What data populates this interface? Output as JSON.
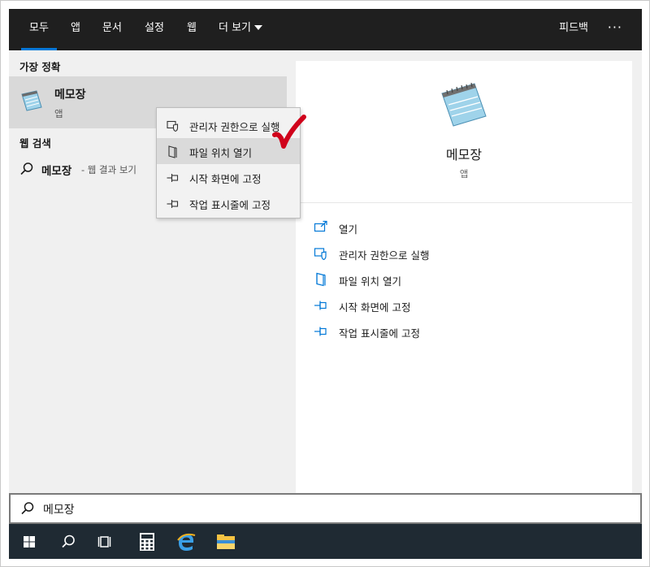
{
  "tabs": [
    {
      "label": "모두",
      "active": true
    },
    {
      "label": "앱"
    },
    {
      "label": "문서"
    },
    {
      "label": "설정"
    },
    {
      "label": "웹"
    },
    {
      "label": "더 보기"
    }
  ],
  "topbar": {
    "feedback": "피드백",
    "more": "···"
  },
  "left": {
    "best_match_title": "가장 정확",
    "best_match": {
      "name": "메모장",
      "kind": "앱",
      "icon": "notepad-icon"
    },
    "web_title": "웹 검색",
    "web_query": "메모장",
    "web_hint": "- 웹 결과 보기"
  },
  "context_menu": {
    "items": [
      {
        "label": "관리자 권한으로 실행",
        "icon": "shield-icon"
      },
      {
        "label": "파일 위치 열기",
        "icon": "folder-location-icon",
        "highlighted": true
      },
      {
        "label": "시작 화면에 고정",
        "icon": "pin-icon"
      },
      {
        "label": "작업 표시줄에 고정",
        "icon": "pin-icon"
      }
    ]
  },
  "right": {
    "title": "메모장",
    "subtitle": "앱",
    "actions": [
      {
        "label": "열기",
        "icon": "open-icon"
      },
      {
        "label": "관리자 권한으로 실행",
        "icon": "shield-icon"
      },
      {
        "label": "파일 위치 열기",
        "icon": "folder-location-icon"
      },
      {
        "label": "시작 화면에 고정",
        "icon": "pin-icon"
      },
      {
        "label": "작업 표시줄에 고정",
        "icon": "pin-icon"
      }
    ]
  },
  "search": {
    "value": "메모장"
  },
  "taskbar": {
    "items": [
      "windows-start-icon",
      "search-icon",
      "task-view-icon",
      "calculator-icon",
      "edge-icon",
      "file-explorer-icon"
    ]
  },
  "colors": {
    "accent": "#0078d7",
    "topbar": "#1f1f1f",
    "taskbar": "#1f2a33",
    "annotation": "#d0021b"
  }
}
